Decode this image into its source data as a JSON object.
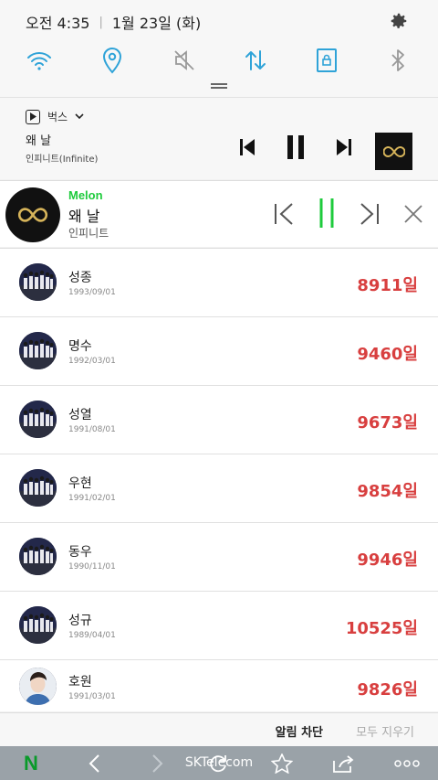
{
  "status": {
    "time": "오전 4:35",
    "date": "1월 23일 (화)"
  },
  "quick_toggles": [
    "wifi-icon",
    "location-icon",
    "sound-off-icon",
    "mobile-data-icon",
    "rotation-lock-icon",
    "bluetooth-icon"
  ],
  "bugs": {
    "app_name": "벅스",
    "title": "왜 날",
    "artist": "인피니트(Infinite)"
  },
  "melon": {
    "brand": "Melon",
    "title": "왜 날",
    "artist": "인피니트",
    "accent": "#1ecb3c"
  },
  "members": [
    {
      "name": "성종",
      "birth": "1993/09/01",
      "days": "8911일"
    },
    {
      "name": "명수",
      "birth": "1992/03/01",
      "days": "9460일"
    },
    {
      "name": "성열",
      "birth": "1991/08/01",
      "days": "9673일"
    },
    {
      "name": "우현",
      "birth": "1991/02/01",
      "days": "9854일"
    },
    {
      "name": "동우",
      "birth": "1990/11/01",
      "days": "9946일"
    },
    {
      "name": "성규",
      "birth": "1989/04/01",
      "days": "10525일"
    },
    {
      "name": "호원",
      "birth": "1991/03/01",
      "days": "9826일"
    }
  ],
  "actions": {
    "block": "알림 차단",
    "clear_all": "모두 지우기"
  },
  "browser": {
    "logo": "N",
    "carrier": "SKTelecom"
  },
  "colors": {
    "days": "#d83f3f",
    "toggle_active": "#2fa3d8"
  }
}
